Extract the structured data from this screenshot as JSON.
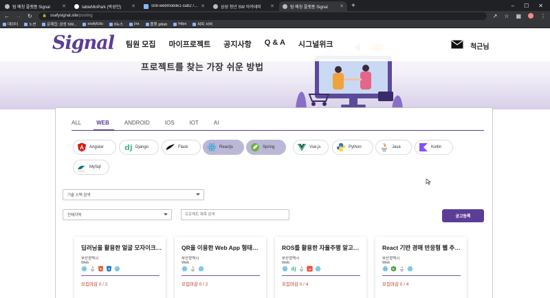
{
  "browser": {
    "tabs": [
      {
        "title": "팀 매칭 플랫폼 Signal",
        "active": false
      },
      {
        "title": "tableMinPark (박성민)",
        "active": false
      },
      {
        "title": "s08-webmobile1-sub2 / S08P12",
        "active": false
      },
      {
        "title": "삼성 청년 SW 아카데미",
        "active": false
      },
      {
        "title": "팀 매칭 플랫폼 Signal",
        "active": true
      }
    ],
    "new_tab": "+",
    "url_host": "ssafysignal.site",
    "url_path": "/posting",
    "bookmarks": [
      "데이터",
      "노션",
      "문제집: 삼성 SW...",
      "ssafyEdu",
      "8뉴스",
      "jira",
      "플랫 gitlab",
      "https",
      "싸피 서버"
    ]
  },
  "nav": {
    "logo": "Signal",
    "menu": [
      "팀원 모집",
      "마이프로젝트",
      "공지사항",
      "Q & A",
      "시그널위크"
    ],
    "user_name": "척근님"
  },
  "hero": {
    "text": "프로젝트를 찾는 가장 쉬운 방법"
  },
  "category_tabs": [
    "ALL",
    "WEB",
    "ANDROID",
    "IOS",
    "IOT",
    "AI"
  ],
  "active_tab": "WEB",
  "tech_chips": [
    {
      "label": "Angular",
      "icon": "angular-icon",
      "selected": false
    },
    {
      "label": "Django",
      "icon": "django-icon",
      "selected": false
    },
    {
      "label": "Flask",
      "icon": "flask-icon",
      "selected": false
    },
    {
      "label": "Reactjs",
      "icon": "react-icon",
      "selected": true
    },
    {
      "label": "Spring",
      "icon": "spring-icon",
      "selected": true
    },
    {
      "label": "Vue.js",
      "icon": "vue-icon",
      "selected": false
    },
    {
      "label": "Python",
      "icon": "python-icon",
      "selected": false
    },
    {
      "label": "Java",
      "icon": "java-icon",
      "selected": false
    },
    {
      "label": "Kotlin",
      "icon": "kotlin-icon",
      "selected": false
    },
    {
      "label": "MySql",
      "icon": "mysql-icon",
      "selected": false
    }
  ],
  "filters": {
    "tech_search": "기술 스택 검색",
    "region": "전체지역",
    "title_search_placeholder": "프로젝트 제목 검색",
    "register_button": "공고등록"
  },
  "projects": [
    {
      "title": "딥러닝을 활용한 얼굴 모자이크 자동...",
      "region": "부산광역시",
      "field": "Web",
      "stack": [
        "react-icon",
        "java-icon",
        "html5-icon",
        "css3-icon",
        "react-icon"
      ],
      "status_label": "모집마감",
      "count": "0 / 2"
    },
    {
      "title": "QR을 이용한 Web App 형태의 결제...",
      "region": "부산광역시",
      "field": "Web",
      "stack": [
        "react-icon",
        "java-icon",
        "react-icon"
      ],
      "status_label": "모집마감",
      "count": "0 / 2"
    },
    {
      "title": "ROS를 활용한 자율주행 알고리즘 개...",
      "region": "부산광역시",
      "field": "Web",
      "stack": [
        "react-icon",
        "django-icon",
        "java-icon",
        "swift-icon",
        "react-icon"
      ],
      "status_label": "모집마감",
      "count": "0 / 4"
    },
    {
      "title": "React 기반 경매 반응형 웹 추가 개발",
      "region": "부산광역시",
      "field": "Web",
      "stack": [
        "react-icon",
        "nodejs-icon",
        "java-icon",
        "react-icon"
      ],
      "status_label": "모집마감",
      "count": "0 / 4"
    }
  ]
}
